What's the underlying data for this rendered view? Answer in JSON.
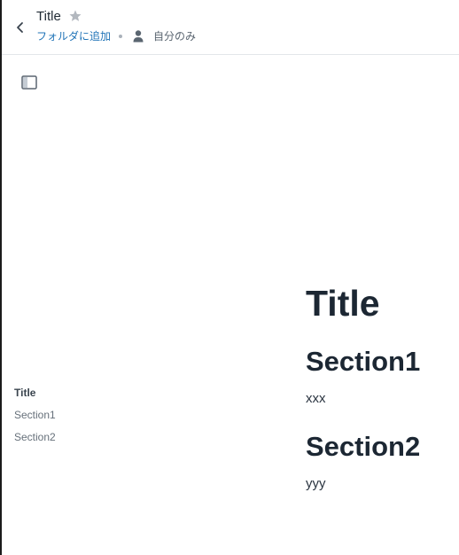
{
  "header": {
    "title": "Title",
    "add_to_folder": "フォルダに追加",
    "visibility": "自分のみ"
  },
  "icons": {
    "back": "chevron-left-icon",
    "star": "star-icon",
    "person": "person-icon",
    "sidebar_toggle": "sidebar-panel-icon"
  },
  "toc": {
    "items": [
      {
        "label": "Title",
        "active": true
      },
      {
        "label": "Section1",
        "active": false
      },
      {
        "label": "Section2",
        "active": false
      }
    ]
  },
  "document": {
    "title": "Title",
    "sections": [
      {
        "heading": "Section1",
        "body": "xxx"
      },
      {
        "heading": "Section2",
        "body": "yyy"
      }
    ]
  },
  "colors": {
    "link": "#1f73b7",
    "heading": "#1c2733",
    "muted": "#66707a",
    "star": "#b3b8bf"
  }
}
